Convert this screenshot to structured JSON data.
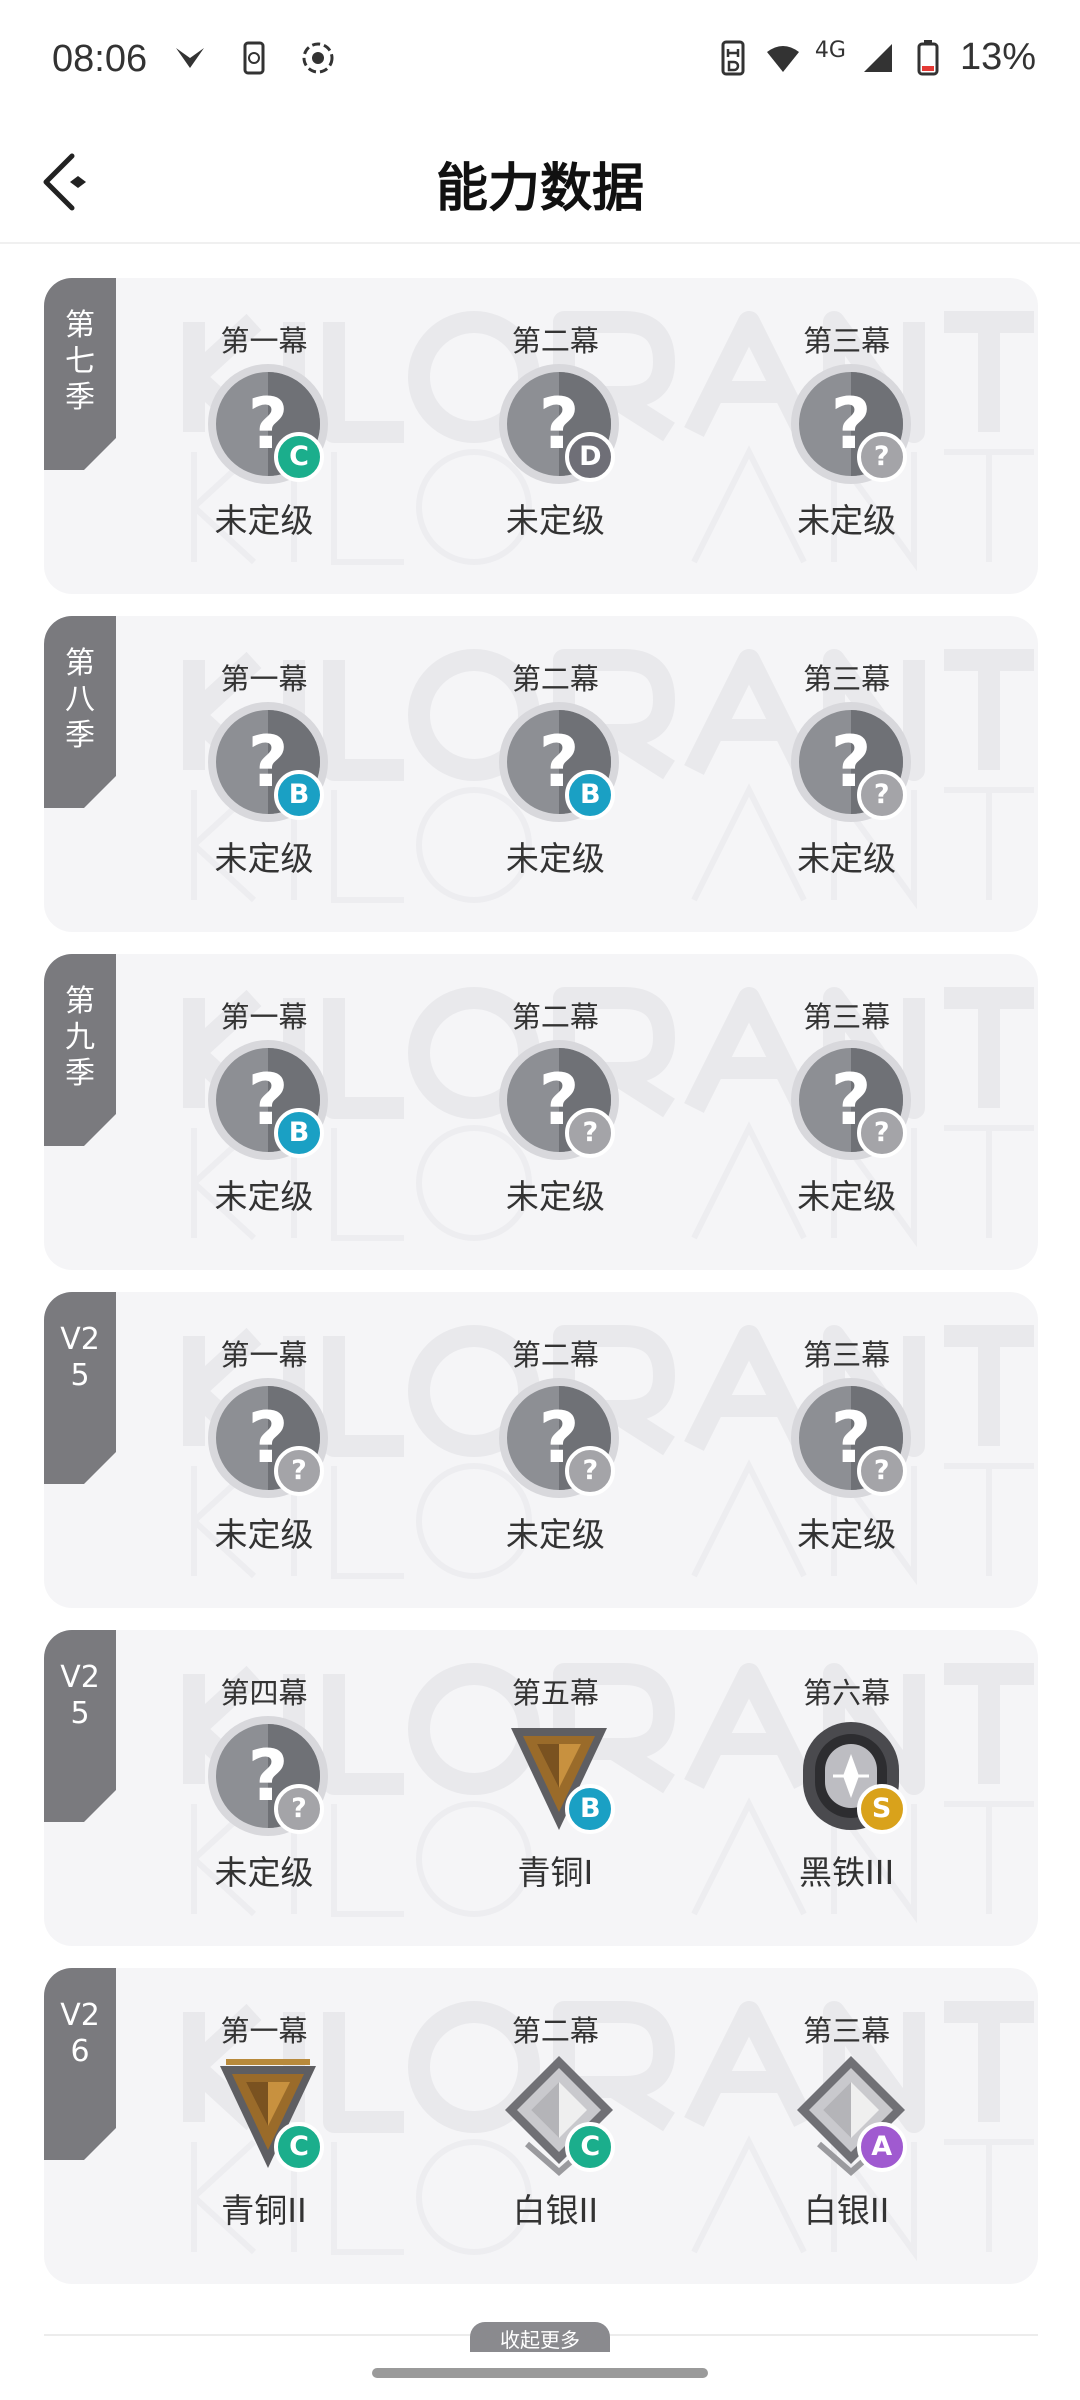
{
  "status_bar": {
    "time": "08:06",
    "network": "4G",
    "battery": "13%",
    "icons": [
      "notification-icon",
      "phone-sync-icon",
      "screen-record-icon",
      "hd-icon",
      "wifi-icon",
      "signal-icon",
      "battery-icon"
    ]
  },
  "header": {
    "title": "能力数据",
    "back_icon": "back-icon"
  },
  "seasons": [
    {
      "label": "第七季",
      "acts": [
        {
          "title": "第一幕",
          "grade": "C",
          "rank": "未定级",
          "badge": "unranked"
        },
        {
          "title": "第二幕",
          "grade": "D",
          "rank": "未定级",
          "badge": "unranked"
        },
        {
          "title": "第三幕",
          "grade": "?",
          "rank": "未定级",
          "badge": "unranked"
        }
      ]
    },
    {
      "label": "第八季",
      "acts": [
        {
          "title": "第一幕",
          "grade": "B",
          "rank": "未定级",
          "badge": "unranked"
        },
        {
          "title": "第二幕",
          "grade": "B",
          "rank": "未定级",
          "badge": "unranked"
        },
        {
          "title": "第三幕",
          "grade": "?",
          "rank": "未定级",
          "badge": "unranked"
        }
      ]
    },
    {
      "label": "第九季",
      "acts": [
        {
          "title": "第一幕",
          "grade": "B",
          "rank": "未定级",
          "badge": "unranked"
        },
        {
          "title": "第二幕",
          "grade": "?",
          "rank": "未定级",
          "badge": "unranked"
        },
        {
          "title": "第三幕",
          "grade": "?",
          "rank": "未定级",
          "badge": "unranked"
        }
      ]
    },
    {
      "label": "V25",
      "acts": [
        {
          "title": "第一幕",
          "grade": "?",
          "rank": "未定级",
          "badge": "unranked"
        },
        {
          "title": "第二幕",
          "grade": "?",
          "rank": "未定级",
          "badge": "unranked"
        },
        {
          "title": "第三幕",
          "grade": "?",
          "rank": "未定级",
          "badge": "unranked"
        }
      ]
    },
    {
      "label": "V25",
      "acts": [
        {
          "title": "第四幕",
          "grade": "?",
          "rank": "未定级",
          "badge": "unranked"
        },
        {
          "title": "第五幕",
          "grade": "B",
          "rank": "青铜I",
          "badge": "bronze1"
        },
        {
          "title": "第六幕",
          "grade": "S",
          "rank": "黑铁III",
          "badge": "iron3"
        }
      ]
    },
    {
      "label": "V26",
      "acts": [
        {
          "title": "第一幕",
          "grade": "C",
          "rank": "青铜II",
          "badge": "bronze2"
        },
        {
          "title": "第二幕",
          "grade": "C",
          "rank": "白银II",
          "badge": "silver2"
        },
        {
          "title": "第三幕",
          "grade": "A",
          "rank": "白银II",
          "badge": "silver2"
        }
      ]
    }
  ],
  "grade_colors": {
    "S": "#d9a21b",
    "A": "#a05ad0",
    "B": "#1aa0c4",
    "C": "#1bae8c",
    "D": "#6f6f77",
    "?": "#a4a4a8"
  },
  "footer": {
    "more_label": "收起更多"
  }
}
